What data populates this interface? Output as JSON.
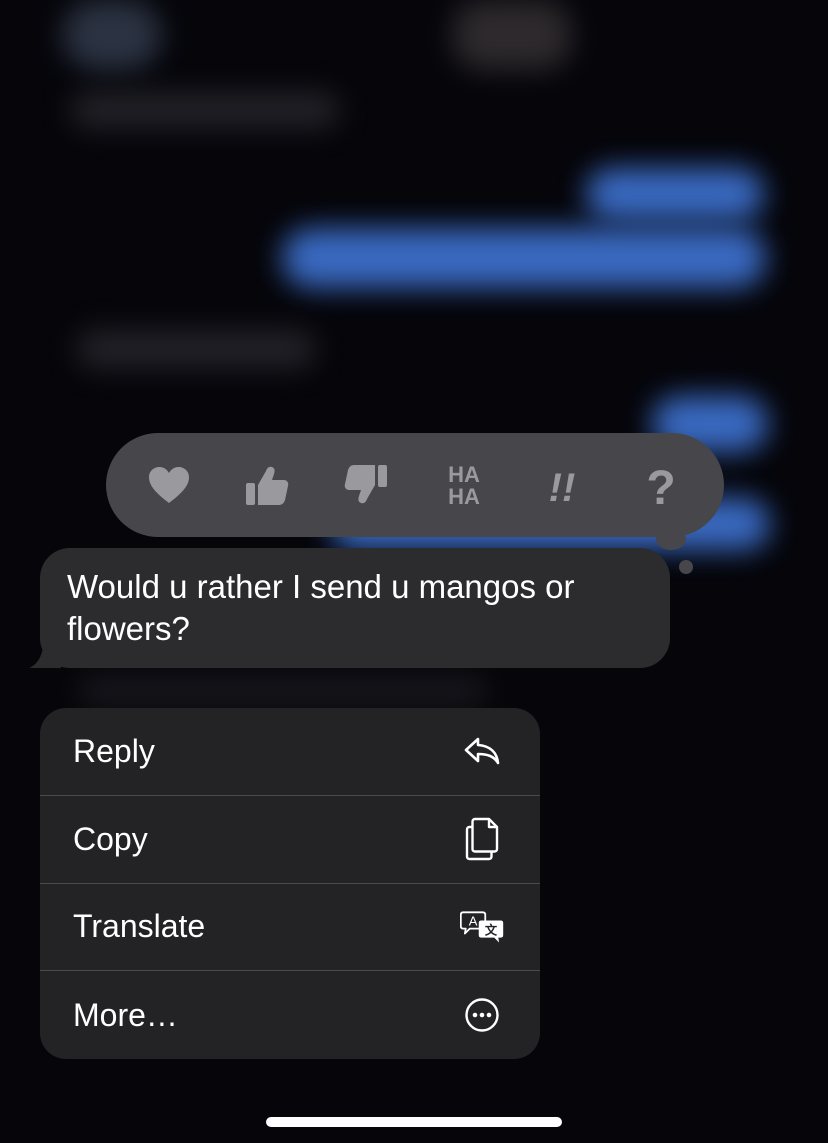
{
  "reactions": [
    {
      "name": "heart-icon",
      "label": "Heart"
    },
    {
      "name": "thumbs-up-icon",
      "label": "Like"
    },
    {
      "name": "thumbs-down-icon",
      "label": "Dislike"
    },
    {
      "name": "haha-icon",
      "label": "HA HA"
    },
    {
      "name": "exclamation-icon",
      "label": "!!"
    },
    {
      "name": "question-icon",
      "label": "?"
    }
  ],
  "reaction_text": {
    "haha_top": "HA",
    "haha_bottom": "HA",
    "emphasize": "!!",
    "question": "?"
  },
  "message": {
    "text": "Would u rather I send u mangos or flowers?"
  },
  "menu": {
    "items": [
      {
        "label": "Reply",
        "icon": "reply-icon"
      },
      {
        "label": "Copy",
        "icon": "copy-icon"
      },
      {
        "label": "Translate",
        "icon": "translate-icon"
      },
      {
        "label": "More…",
        "icon": "more-icon"
      }
    ]
  },
  "colors": {
    "background": "#05050a",
    "tapback": "#47474b",
    "reaction_glyph": "#9a9a9e",
    "bubble": "#2c2c2f",
    "menu": "#232325",
    "blurred_blue": "#3f74d4"
  }
}
